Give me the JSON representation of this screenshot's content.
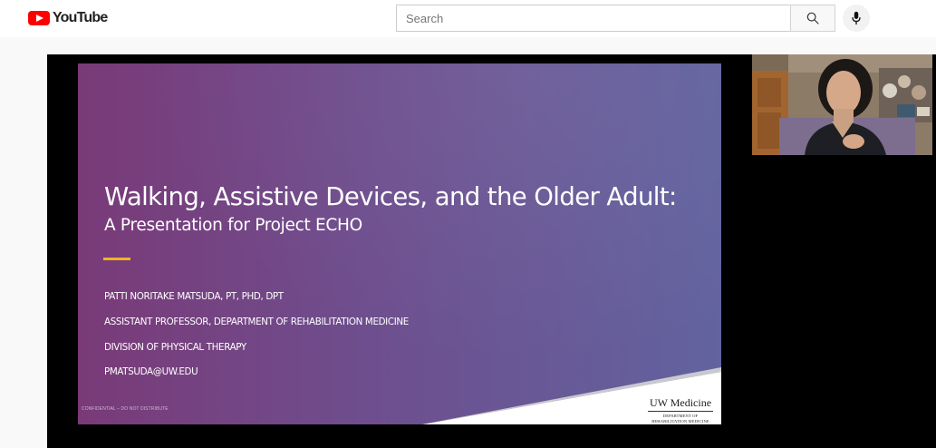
{
  "header": {
    "logo_text": "YouTube",
    "search_placeholder": "Search",
    "icons": [
      "youtube-logo-icon",
      "search-icon",
      "mic-icon"
    ]
  },
  "slide": {
    "title": "Walking, Assistive Devices, and the Older Adult:",
    "subtitle": "A Presentation for Project ECHO",
    "lines": [
      "PATTI NORITAKE MATSUDA, PT, PHD, DPT",
      "ASSISTANT PROFESSOR, DEPARTMENT OF REHABILITATION MEDICINE",
      "DIVISION OF PHYSICAL THERAPY",
      "PMATSUDA@UW.EDU"
    ],
    "footer_note": "CONFIDENTIAL – DO NOT DISTRIBUTE",
    "logo_name": "UW Medicine",
    "logo_dept": "DEPARTMENT OF\nREHABILITATION MEDICINE",
    "colors": {
      "bg_left": "#7a3a78",
      "bg_right": "#62639f",
      "accent": "#f0b323"
    }
  }
}
